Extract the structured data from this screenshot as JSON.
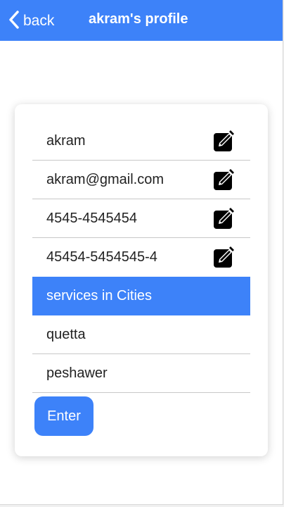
{
  "header": {
    "back_label": "back",
    "title": "akram's profile",
    "color": "#3d82f9"
  },
  "profile": {
    "fields": [
      {
        "value": "akram",
        "edit_icon": "edit-icon"
      },
      {
        "value": "akram@gmail.com",
        "edit_icon": "edit-icon"
      },
      {
        "value": "4545-4545454",
        "edit_icon": "edit-icon"
      },
      {
        "value": "45454-5454545-4",
        "edit_icon": "edit-icon"
      }
    ]
  },
  "services": {
    "heading": "services in Cities",
    "cities": [
      "quetta",
      "peshawer"
    ]
  },
  "actions": {
    "enter_label": "Enter"
  }
}
